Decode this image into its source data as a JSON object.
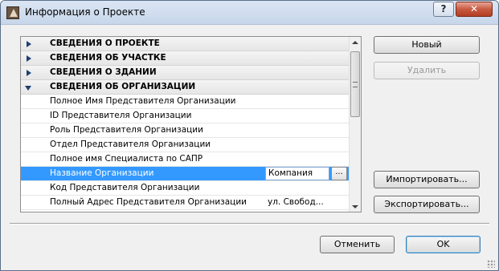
{
  "window": {
    "title": "Информация о Проекте",
    "help_label": "?",
    "close_label": "✕"
  },
  "grid": {
    "groups": [
      {
        "label": "СВЕДЕНИЯ О ПРОЕКТЕ",
        "expanded": false
      },
      {
        "label": "СВЕДЕНИЯ ОБ УЧАСТКЕ",
        "expanded": false
      },
      {
        "label": "СВЕДЕНИЯ О ЗДАНИИ",
        "expanded": false
      },
      {
        "label": "СВЕДЕНИЯ ОБ ОРГАНИЗАЦИИ",
        "expanded": true
      }
    ],
    "rows": [
      {
        "name": "Полное Имя Представителя Организации",
        "value": ""
      },
      {
        "name": "ID Представителя Организации",
        "value": ""
      },
      {
        "name": "Роль Представителя Организации",
        "value": ""
      },
      {
        "name": "Отдел Представителя Организации",
        "value": ""
      },
      {
        "name": "Полное имя Специалиста по САПР",
        "value": ""
      },
      {
        "name": "Название Организации",
        "value": "Компания",
        "selected": true,
        "more_label": "..."
      },
      {
        "name": "Код Представителя Организации",
        "value": ""
      },
      {
        "name": "Полный Адрес Представителя Организации",
        "value": "ул. Свобод..."
      }
    ]
  },
  "buttons": {
    "new": "Новый",
    "delete": "Удалить",
    "import": "Импортировать...",
    "export": "Экспортировать...",
    "cancel": "Отменить",
    "ok": "OK"
  },
  "colors": {
    "selection": "#3399ff",
    "group_caret": "#1f3f6f",
    "default_button_border": "#3c7fb1"
  }
}
